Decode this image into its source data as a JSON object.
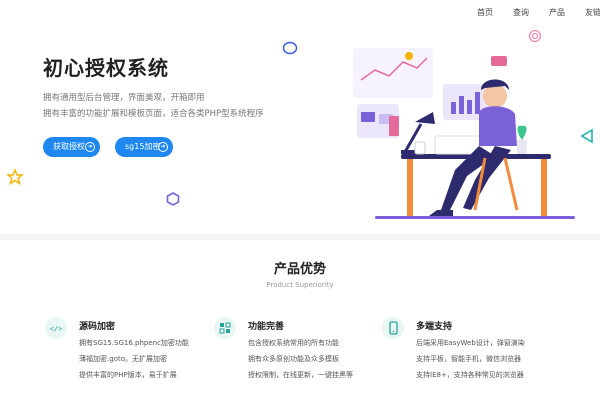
{
  "nav": {
    "items": [
      "首页",
      "查询",
      "产品",
      "友链"
    ]
  },
  "hero": {
    "title": "初心授权系统",
    "line1": "拥有通用型后台管理，界面美观，开箱即用",
    "line2": "拥有丰富的功能扩展和模板页面，适合各类PHP型系统程序",
    "button1": "获取授权",
    "button2": "sg15加密"
  },
  "section": {
    "title": "产品优势",
    "subtitle": "Product Superiority"
  },
  "features": [
    {
      "icon": "code-icon",
      "title": "源码加密",
      "lines": [
        "拥有SG15.SG16.phpenc加密功能",
        "薄福加密.goto。无扩展加密",
        "提供丰富的PHP版本，易于扩展"
      ]
    },
    {
      "icon": "modules-icon",
      "title": "功能完善",
      "lines": [
        "包含授权系统常用的所有功能",
        "拥有众多原创功能及众多模板",
        "授权限制，在线更新，一键挂黑等"
      ]
    },
    {
      "icon": "mobile-icon",
      "title": "多端支持",
      "lines": [
        "后端采用EasyWeb设计，弹窗演染",
        "支持平板，智能手机，微信浏览器",
        "支持IE8+，支持各种常见的浏览器"
      ]
    }
  ],
  "colors": {
    "accent": "#1e88f0",
    "purple": "#7b61d8",
    "orange": "#f28b3c"
  }
}
